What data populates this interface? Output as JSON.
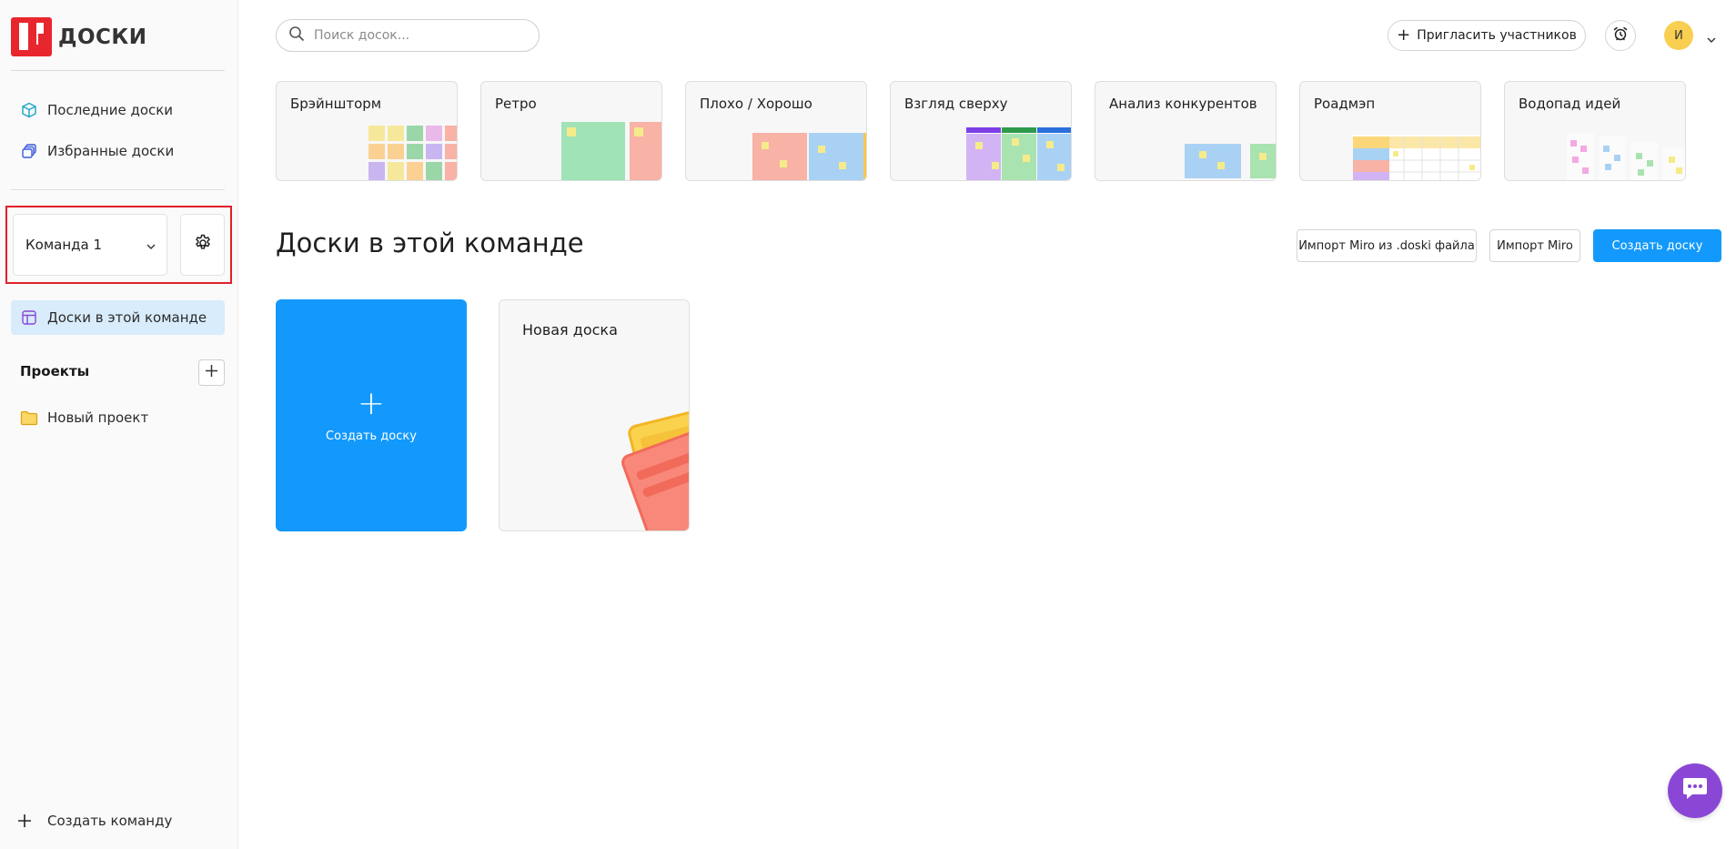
{
  "app": {
    "logo_text": "ДОСКИ",
    "brand_color": "#e8262d",
    "accent_color": "#1399fb"
  },
  "sidebar": {
    "nav": [
      {
        "label": "Последние доски",
        "icon": "cube-icon"
      },
      {
        "label": "Избранные доски",
        "icon": "stacked-boards-icon"
      }
    ],
    "team": {
      "selected": "Команда 1",
      "settings_icon": "gear-icon"
    },
    "active_item": {
      "label": "Доски в этой команде",
      "icon": "board-layout-icon"
    },
    "projects": {
      "title": "Проекты",
      "items": [
        {
          "label": "Новый проект",
          "icon": "folder-icon"
        }
      ]
    },
    "create_team_label": "Создать команду"
  },
  "header": {
    "search_placeholder": "Поиск досок...",
    "invite_label": "Пригласить участников",
    "avatar_initial": "И"
  },
  "templates": [
    {
      "title": "Брэйншторм"
    },
    {
      "title": "Ретро"
    },
    {
      "title": "Плохо / Хорошо"
    },
    {
      "title": "Взгляд сверху"
    },
    {
      "title": "Анализ конкурентов"
    },
    {
      "title": "Роадмэп"
    },
    {
      "title": "Водопад идей"
    }
  ],
  "main": {
    "section_title": "Доски в этой команде",
    "import_doski_label": "Импорт Miro из .doski файла",
    "import_miro_label": "Импорт Miro",
    "create_board_label": "Создать доску",
    "create_card_label": "Создать доску",
    "boards": [
      {
        "name": "Новая доска"
      }
    ]
  }
}
